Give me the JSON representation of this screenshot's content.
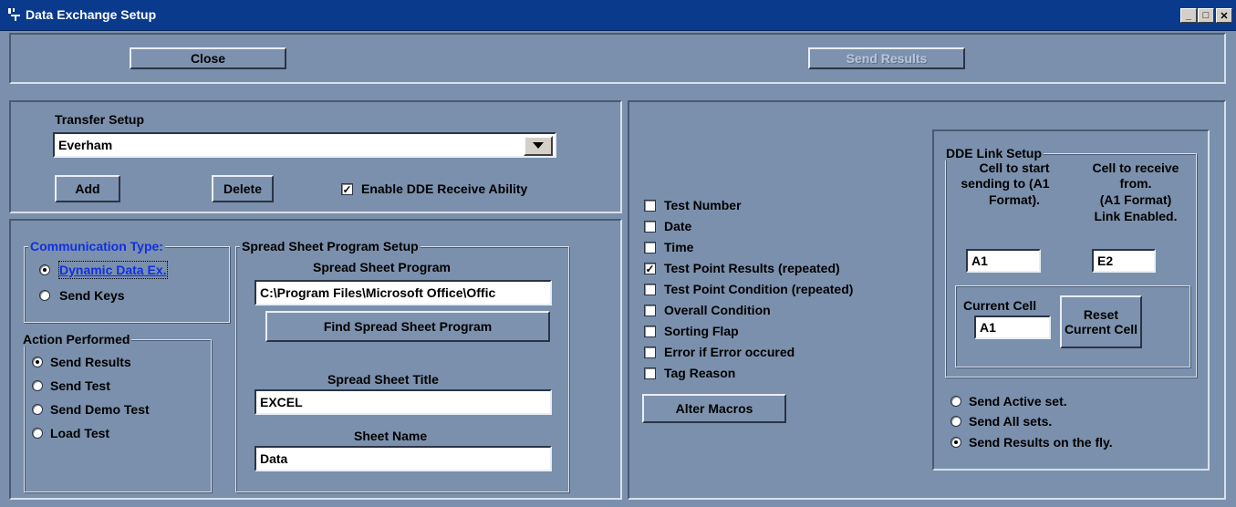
{
  "window": {
    "title": "Data Exchange Setup",
    "controls": [
      "_",
      "□",
      "✕"
    ]
  },
  "toolbar": {
    "close_label": "Close",
    "send_results_label": "Send Results"
  },
  "transfer": {
    "heading": "Transfer Setup",
    "selected": "Everham",
    "add_label": "Add",
    "delete_label": "Delete",
    "enable_dde_label": "Enable DDE Receive Ability",
    "enable_dde_checked": true
  },
  "communication": {
    "legend": "Communication Type:",
    "options": [
      {
        "label": "Dynamic Data Ex.",
        "selected": true
      },
      {
        "label": "Send Keys",
        "selected": false
      }
    ]
  },
  "action": {
    "legend": "Action Performed",
    "options": [
      {
        "label": "Send Results",
        "selected": true
      },
      {
        "label": "Send Test",
        "selected": false
      },
      {
        "label": "Send Demo Test",
        "selected": false
      },
      {
        "label": "Load Test",
        "selected": false
      }
    ]
  },
  "spreadsheet": {
    "legend": "Spread Sheet Program Setup",
    "program_label": "Spread Sheet Program",
    "program_value": "C:\\Program Files\\Microsoft Office\\Offic",
    "find_label": "Find Spread Sheet Program",
    "title_label": "Spread Sheet Title",
    "title_value": "EXCEL",
    "sheet_label": "Sheet Name",
    "sheet_value": "Data"
  },
  "fields": [
    {
      "label": "Test Number",
      "checked": false
    },
    {
      "label": "Date",
      "checked": false
    },
    {
      "label": "Time",
      "checked": false
    },
    {
      "label": "Test Point Results (repeated)",
      "checked": true
    },
    {
      "label": "Test Point Condition (repeated)",
      "checked": false
    },
    {
      "label": "Overall Condition",
      "checked": false
    },
    {
      "label": "Sorting Flap",
      "checked": false
    },
    {
      "label": "Error if Error occured",
      "checked": false
    },
    {
      "label": "Tag Reason",
      "checked": false
    }
  ],
  "alter_macros_label": "Alter Macros",
  "dde": {
    "legend": "DDE Link Setup",
    "send_col_label_1": "Cell to start",
    "send_col_label_2": "sending to (A1",
    "send_col_label_3": "Format).",
    "recv_col_label_1": "Cell to receive",
    "recv_col_label_2": "from.",
    "recv_col_label_3": "(A1 Format)",
    "recv_col_label_4": "Link Enabled.",
    "send_cell": "A1",
    "recv_cell": "E2",
    "current_cell_label": "Current Cell",
    "current_cell": "A1",
    "reset_label_1": "Reset",
    "reset_label_2": "Current Cell"
  },
  "send_mode": [
    {
      "label": "Send Active set.",
      "selected": false
    },
    {
      "label": "Send All sets.",
      "selected": false
    },
    {
      "label": "Send Results on the fly.",
      "selected": true
    }
  ]
}
